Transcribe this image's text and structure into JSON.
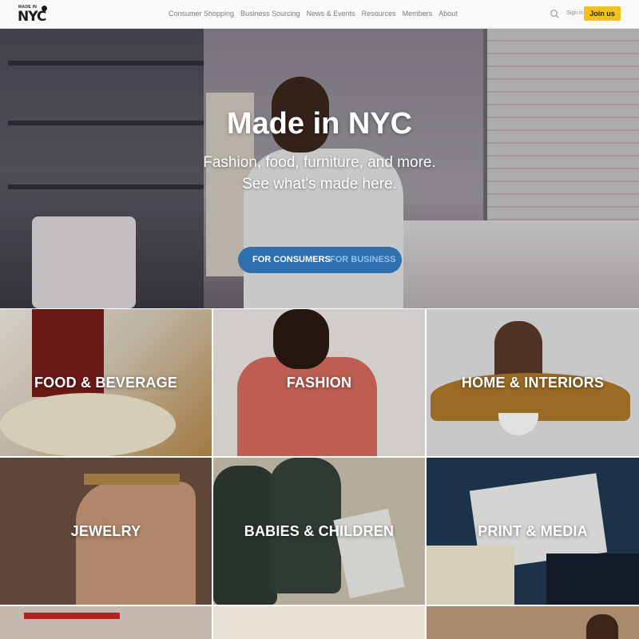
{
  "nav": {
    "logo_small": "MADE IN",
    "logo_big": "NYC",
    "links": [
      "Consumer Shopping",
      "Business Sourcing",
      "News & Events",
      "Resources",
      "Members",
      "About"
    ],
    "signin": "Sign in",
    "join": "Join us"
  },
  "hero": {
    "title": "Made in NYC",
    "subtitle_line1": "Fashion, food, furniture, and more.",
    "subtitle_line2": "See what's made here.",
    "toggle_consumers": "FOR CONSUMERS",
    "toggle_business": "FOR BUSINESS"
  },
  "categories": [
    "FOOD & BEVERAGE",
    "FASHION",
    "HOME & INTERIORS",
    "JEWELRY",
    "BABIES & CHILDREN",
    "PRINT & MEDIA"
  ],
  "colors": {
    "accent_yellow": "#f2c01a",
    "toggle_blue": "#2e6fae"
  }
}
